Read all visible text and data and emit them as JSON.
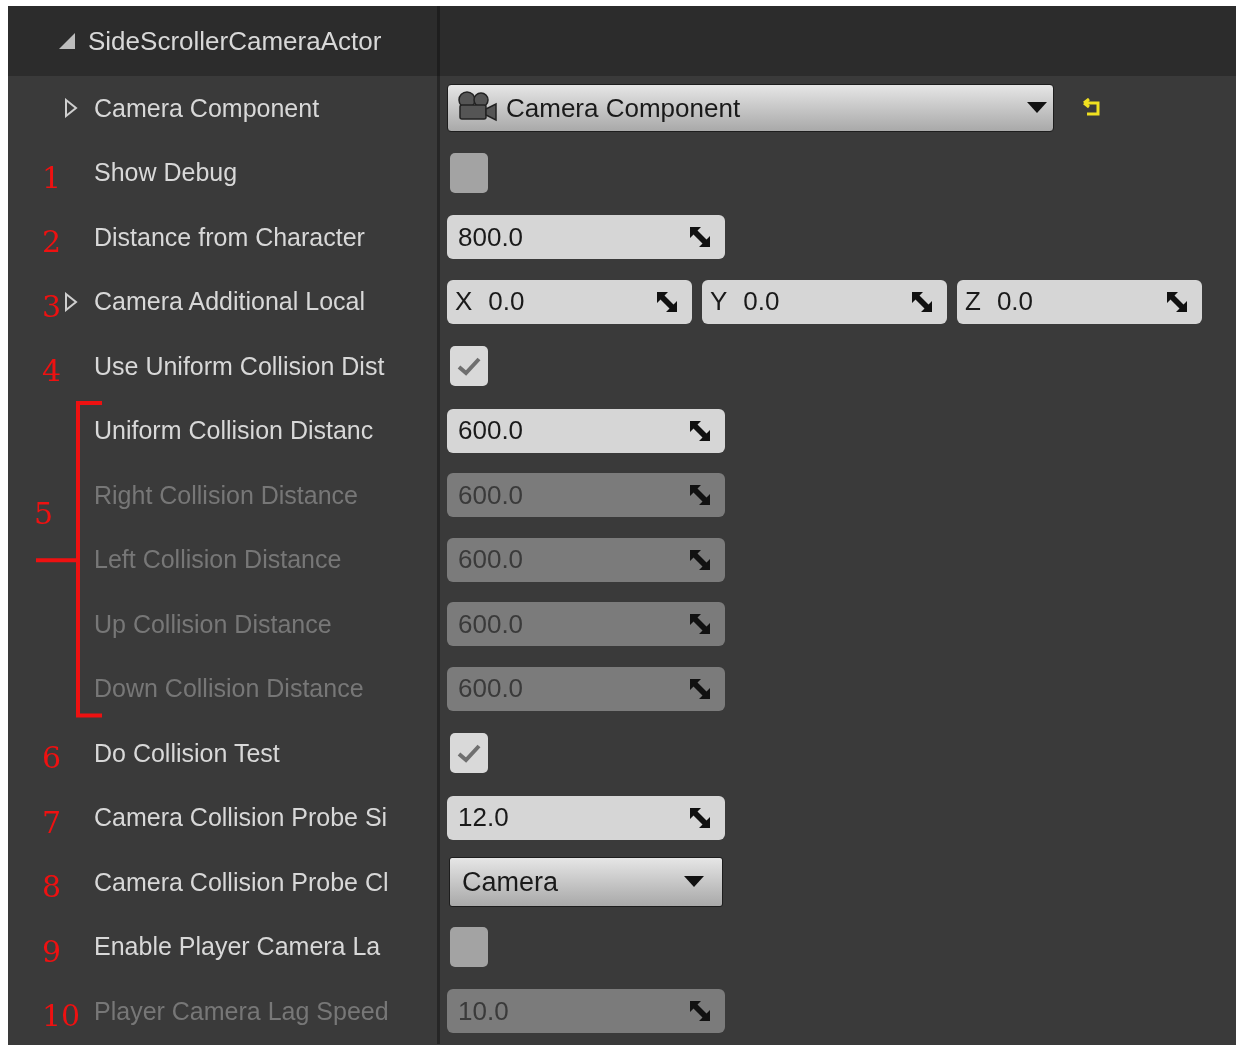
{
  "header": {
    "title": "SideScrollerCameraActor",
    "expanded": true
  },
  "bracket": {
    "label": "5"
  },
  "rows": [
    {
      "kind": "object",
      "label": "Camera Component",
      "expandable": true,
      "value": "Camera Component",
      "revert": true
    },
    {
      "kind": "checkbox",
      "note": "1",
      "label": "Show Debug",
      "checked": false,
      "disabled": false
    },
    {
      "kind": "number",
      "note": "2",
      "label": "Distance from Character",
      "value": "800.0",
      "disabled": false
    },
    {
      "kind": "vector",
      "note": "3",
      "label": "Camera Additional Local",
      "expandable": true,
      "values": [
        {
          "axis": "X",
          "value": "0.0"
        },
        {
          "axis": "Y",
          "value": "0.0"
        },
        {
          "axis": "Z",
          "value": "0.0"
        }
      ]
    },
    {
      "kind": "checkbox",
      "note": "4",
      "label": "Use Uniform Collision Dist",
      "checked": true,
      "disabled": false
    },
    {
      "kind": "number",
      "label": "Uniform Collision Distanc",
      "value": "600.0",
      "disabled": false,
      "bracketed": true
    },
    {
      "kind": "number",
      "label": "Right Collision Distance",
      "value": "600.0",
      "disabled": true,
      "bracketed": true
    },
    {
      "kind": "number",
      "label": "Left Collision Distance",
      "value": "600.0",
      "disabled": true,
      "bracketed": true
    },
    {
      "kind": "number",
      "label": "Up Collision Distance",
      "value": "600.0",
      "disabled": true,
      "bracketed": true
    },
    {
      "kind": "number",
      "label": "Down Collision Distance",
      "value": "600.0",
      "disabled": true,
      "bracketed": true
    },
    {
      "kind": "checkbox",
      "note": "6",
      "label": "Do Collision Test",
      "checked": true,
      "disabled": false
    },
    {
      "kind": "number",
      "note": "7",
      "label": "Camera Collision Probe Si",
      "value": "12.0",
      "disabled": false
    },
    {
      "kind": "enum",
      "note": "8",
      "label": "Camera Collision Probe Cl",
      "value": "Camera"
    },
    {
      "kind": "checkbox",
      "note": "9",
      "label": "Enable Player Camera La",
      "checked": false,
      "disabled": false
    },
    {
      "kind": "number",
      "note": "10",
      "label": "Player Camera Lag Speed",
      "value": "10.0",
      "disabled": true
    }
  ]
}
